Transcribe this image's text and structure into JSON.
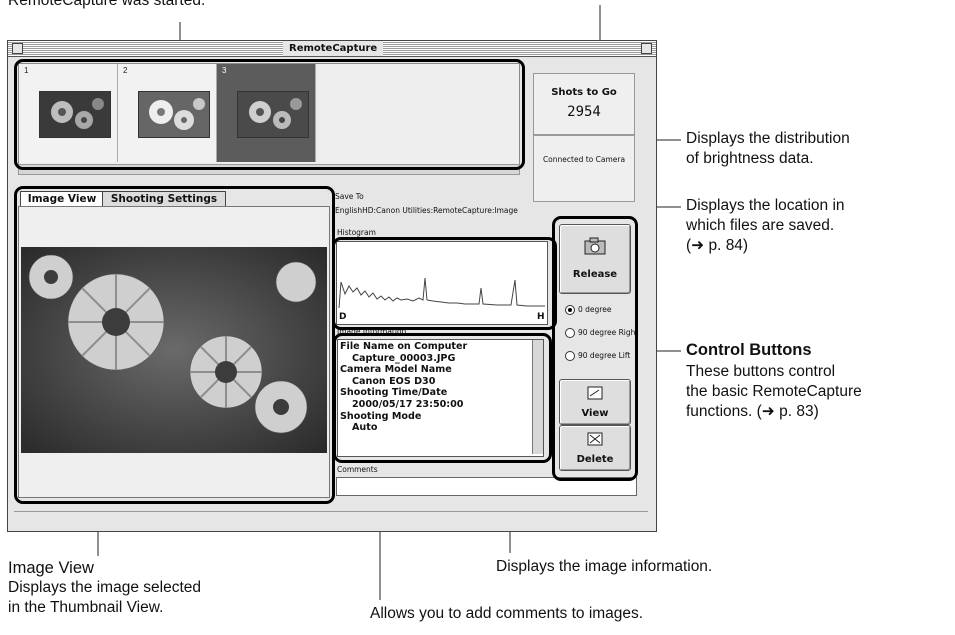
{
  "annotations": {
    "top_left": "RemoteCapture was started.",
    "right": [
      {
        "lines": [
          "Displays the distribution",
          "of brightness data."
        ]
      },
      {
        "lines": [
          "Displays the location in",
          "which files are saved.",
          "(➜ p. 84)"
        ]
      }
    ],
    "control_title": "Control Buttons",
    "control_desc": [
      "These buttons control",
      "the basic RemoteCapture",
      "functions. (➜ p. 83)"
    ],
    "image_view_title": "Image View",
    "image_view_desc": [
      "Displays the image selected",
      "in the Thumbnail View."
    ],
    "image_info": "Displays the image information.",
    "comments": "Allows you to add comments to images."
  },
  "window": {
    "title": "RemoteCapture",
    "thumbnails": [
      {
        "number": "1",
        "selected": false
      },
      {
        "number": "2",
        "selected": false
      },
      {
        "number": "3",
        "selected": true
      }
    ],
    "shots_label": "Shots to Go",
    "shots_value": "2954",
    "status": "Connected to Camera",
    "tabs": [
      "Image View",
      "Shooting Settings"
    ],
    "save_to_label": "Save To",
    "save_to_path": "EnglishHD:Canon Utilities:RemoteCapture:Image",
    "histogram_label": "Histogram",
    "histogram_left": "D",
    "histogram_right": "H",
    "image_info_label": "Image Information",
    "image_info": [
      {
        "label": "File Name on Computer",
        "value": "Capture_00003.JPG"
      },
      {
        "label": "Camera Model Name",
        "value": "Canon EOS D30"
      },
      {
        "label": "Shooting Time/Date",
        "value": "2000/05/17  23:50:00"
      },
      {
        "label": "Shooting Mode",
        "value": "Auto"
      }
    ],
    "comments_label": "Comments",
    "buttons": {
      "release": "Release",
      "view": "View",
      "delete": "Delete"
    },
    "rotation": [
      {
        "label": "0 degree",
        "selected": true
      },
      {
        "label": "90 degree Right",
        "selected": false
      },
      {
        "label": "90 degree Lift",
        "selected": false
      }
    ]
  }
}
